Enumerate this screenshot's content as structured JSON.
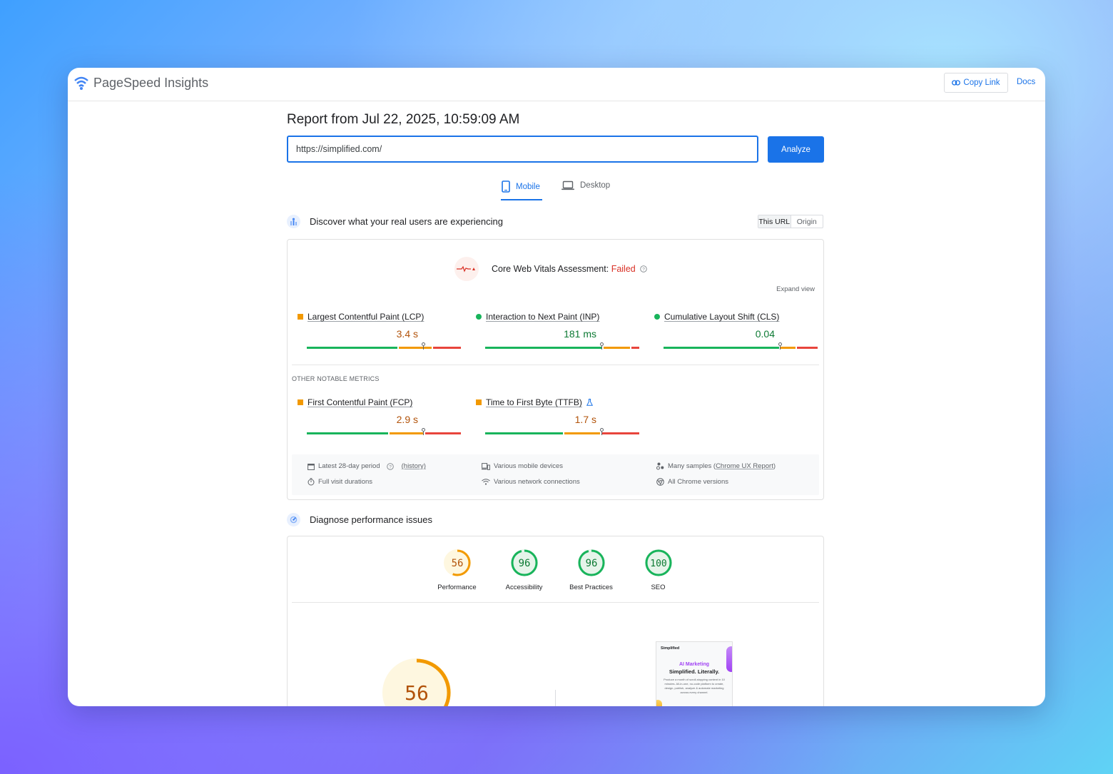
{
  "app": {
    "title": "PageSpeed Insights",
    "copy_link_label": "Copy Link",
    "docs_label": "Docs"
  },
  "report": {
    "title": "Report from Jul 22, 2025, 10:59:09 AM",
    "url_value": "https://simplified.com/",
    "analyze_label": "Analyze"
  },
  "tabs": [
    {
      "label": "Mobile",
      "active": true
    },
    {
      "label": "Desktop",
      "active": false
    }
  ],
  "field_data": {
    "heading": "Discover what your real users are experiencing",
    "toggle": [
      "This URL",
      "Origin"
    ],
    "assessment_label": "Core Web Vitals Assessment:",
    "assessment_status": "Failed",
    "expand_label": "Expand view",
    "core_metrics": [
      {
        "label": "Largest Contentful Paint (LCP)",
        "value": "3.4 s",
        "rating": "average",
        "dist": [
          0.59,
          0.22,
          0.19
        ],
        "marker": 0.75
      },
      {
        "label": "Interaction to Next Paint (INP)",
        "value": "181 ms",
        "rating": "good",
        "dist": [
          0.76,
          0.18,
          0.06
        ],
        "marker": 0.75
      },
      {
        "label": "Cumulative Layout Shift (CLS)",
        "value": "0.04",
        "rating": "good",
        "dist": [
          0.75,
          0.11,
          0.14
        ],
        "marker": 0.75
      }
    ],
    "other_heading": "OTHER NOTABLE METRICS",
    "other_metrics": [
      {
        "label": "First Contentful Paint (FCP)",
        "value": "2.9 s",
        "rating": "average",
        "dist": [
          0.53,
          0.23,
          0.24
        ],
        "marker": 0.75
      },
      {
        "label": "Time to First Byte (TTFB)",
        "value": "1.7 s",
        "rating": "average",
        "dist": [
          0.51,
          0.24,
          0.25
        ],
        "marker": 0.75
      }
    ],
    "footer": {
      "period": "Latest 28-day period",
      "history": "(history)",
      "visits": "Full visit durations",
      "devices": "Various mobile devices",
      "network": "Various network connections",
      "samples_pre": "Many samples (",
      "samples_link": "Chrome UX Report",
      "samples_post": ")",
      "chrome": "All Chrome versions"
    }
  },
  "diagnose": {
    "heading": "Diagnose performance issues",
    "scores": [
      {
        "label": "Performance",
        "value": 56,
        "color": "#f29900",
        "bg": "#fef7e0",
        "text": "#b2530a"
      },
      {
        "label": "Accessibility",
        "value": 96,
        "color": "#18b45b",
        "bg": "#e6f4ea",
        "text": "#0d7a34"
      },
      {
        "label": "Best Practices",
        "value": 96,
        "color": "#18b45b",
        "bg": "#e6f4ea",
        "text": "#0d7a34"
      },
      {
        "label": "SEO",
        "value": 100,
        "color": "#18b45b",
        "bg": "#e6f4ea",
        "text": "#0d7a34"
      }
    ],
    "big_score": 56
  },
  "thumbnail": {
    "logo": "Simplified",
    "headline1": "AI Marketing",
    "headline2": "Simplified. Literally.",
    "body": "Produce a month of scroll-stopping content in 10 minutes. All-in-one, no-code platform to create, design, publish, analyze & automate marketing across every channel."
  },
  "colors": {
    "accent": "#1a73e8",
    "good": "#18b45b",
    "average": "#f29900",
    "poor": "#e8453c",
    "failed": "#d93025"
  }
}
